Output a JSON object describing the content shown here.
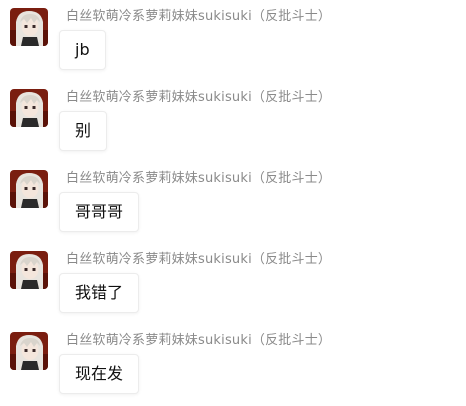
{
  "messages": [
    {
      "sender": "白丝软萌冷系萝莉妹妹sukisuki（反批斗士）",
      "text": "jb",
      "avatar_icon": "anime-girl-avatar-icon"
    },
    {
      "sender": "白丝软萌冷系萝莉妹妹sukisuki（反批斗士）",
      "text": "别",
      "avatar_icon": "anime-girl-avatar-icon"
    },
    {
      "sender": "白丝软萌冷系萝莉妹妹sukisuki（反批斗士）",
      "text": "哥哥哥",
      "avatar_icon": "anime-girl-avatar-icon"
    },
    {
      "sender": "白丝软萌冷系萝莉妹妹sukisuki（反批斗士）",
      "text": "我错了",
      "avatar_icon": "anime-girl-avatar-icon"
    },
    {
      "sender": "白丝软萌冷系萝莉妹妹sukisuki（反批斗士）",
      "text": "现在发",
      "avatar_icon": "anime-girl-avatar-icon"
    }
  ],
  "colors": {
    "sender_text": "#8a8a8a",
    "bubble_border": "#ececec",
    "message_text": "#111111",
    "avatar_background": "#7a1e10",
    "avatar_hair": "#e8e4de"
  }
}
